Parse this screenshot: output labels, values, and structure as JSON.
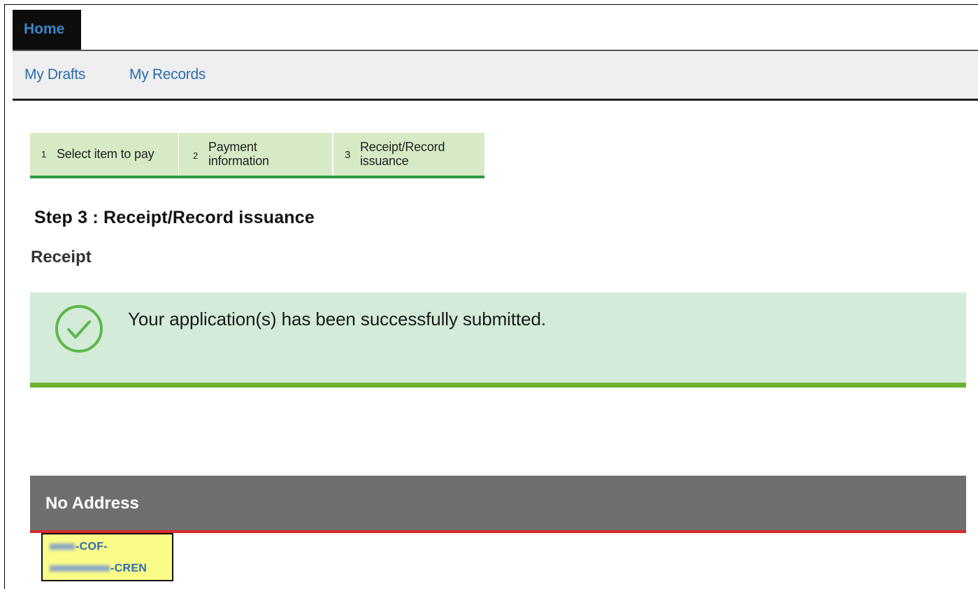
{
  "nav": {
    "home_tab": "Home",
    "items": [
      {
        "label": "My Drafts"
      },
      {
        "label": "My Records"
      }
    ]
  },
  "steps": [
    {
      "num": "1",
      "label": "Select item to pay"
    },
    {
      "num": "2",
      "label": "Payment information"
    },
    {
      "num": "3",
      "label": "Receipt/Record issuance"
    }
  ],
  "page": {
    "step_heading": "Step 3 : Receipt/Record issuance",
    "receipt_heading": "Receipt"
  },
  "alert": {
    "icon": "check-circle-icon",
    "message": "Your application(s) has been successfully submitted."
  },
  "address": {
    "title": "No Address",
    "record_line1_suffix": "-COF-",
    "record_line2_suffix": "-CREN"
  },
  "colors": {
    "accent_green": "#2e9b44",
    "alert_green": "#6ab22e",
    "address_red": "#d82a2a",
    "link_blue": "#2a6cad"
  }
}
